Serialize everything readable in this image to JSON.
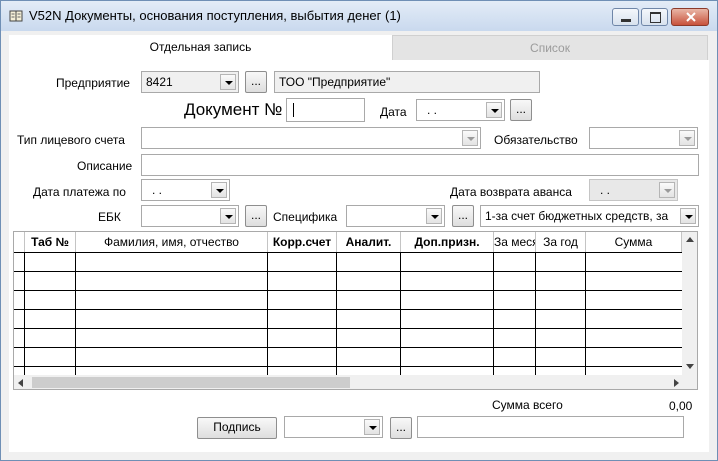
{
  "window": {
    "title": "V52N Документы, основания поступления, выбытия денег (1)",
    "icon": "document-window-icon"
  },
  "tabs": [
    {
      "label": "Отдельная запись",
      "active": true
    },
    {
      "label": "Список",
      "active": false
    }
  ],
  "form": {
    "enterprise_label": "Предприятие",
    "enterprise_code": "8421",
    "enterprise_name": "ТОО  \"Предприятие\"",
    "doc_label": "Документ №",
    "doc_value": "",
    "date_label": "Дата",
    "date_value": ". .",
    "account_type_label": "Тип лицевого счета",
    "account_type_value": "",
    "obligation_label": "Обязательство",
    "obligation_value": "",
    "description_label": "Описание",
    "description_value": "",
    "pay_date_label": "Дата платежа по",
    "pay_date_value": ". .",
    "advance_return_label": "Дата возврата аванса",
    "advance_return_value": ". .",
    "ebk_label": "ЕБК",
    "ebk_value": "",
    "spec_label": "Специфика",
    "spec_value": "",
    "funding_value": "1-за счет бюджетных средств, за",
    "browse_label": "..."
  },
  "grid": {
    "columns": [
      {
        "label": "Таб №",
        "bold": true
      },
      {
        "label": "Фамилия, имя, отчество",
        "bold": false
      },
      {
        "label": "Корр.счет",
        "bold": true
      },
      {
        "label": "Аналит.",
        "bold": true
      },
      {
        "label": "Доп.призн.",
        "bold": true
      },
      {
        "label": "За месяц",
        "bold": false
      },
      {
        "label": "За год",
        "bold": false
      },
      {
        "label": "Сумма",
        "bold": false
      }
    ]
  },
  "footer": {
    "total_label": "Сумма всего",
    "total_value": "0,00",
    "sign_button": "Подпись",
    "sign_select_value": "",
    "sign_text": ""
  }
}
